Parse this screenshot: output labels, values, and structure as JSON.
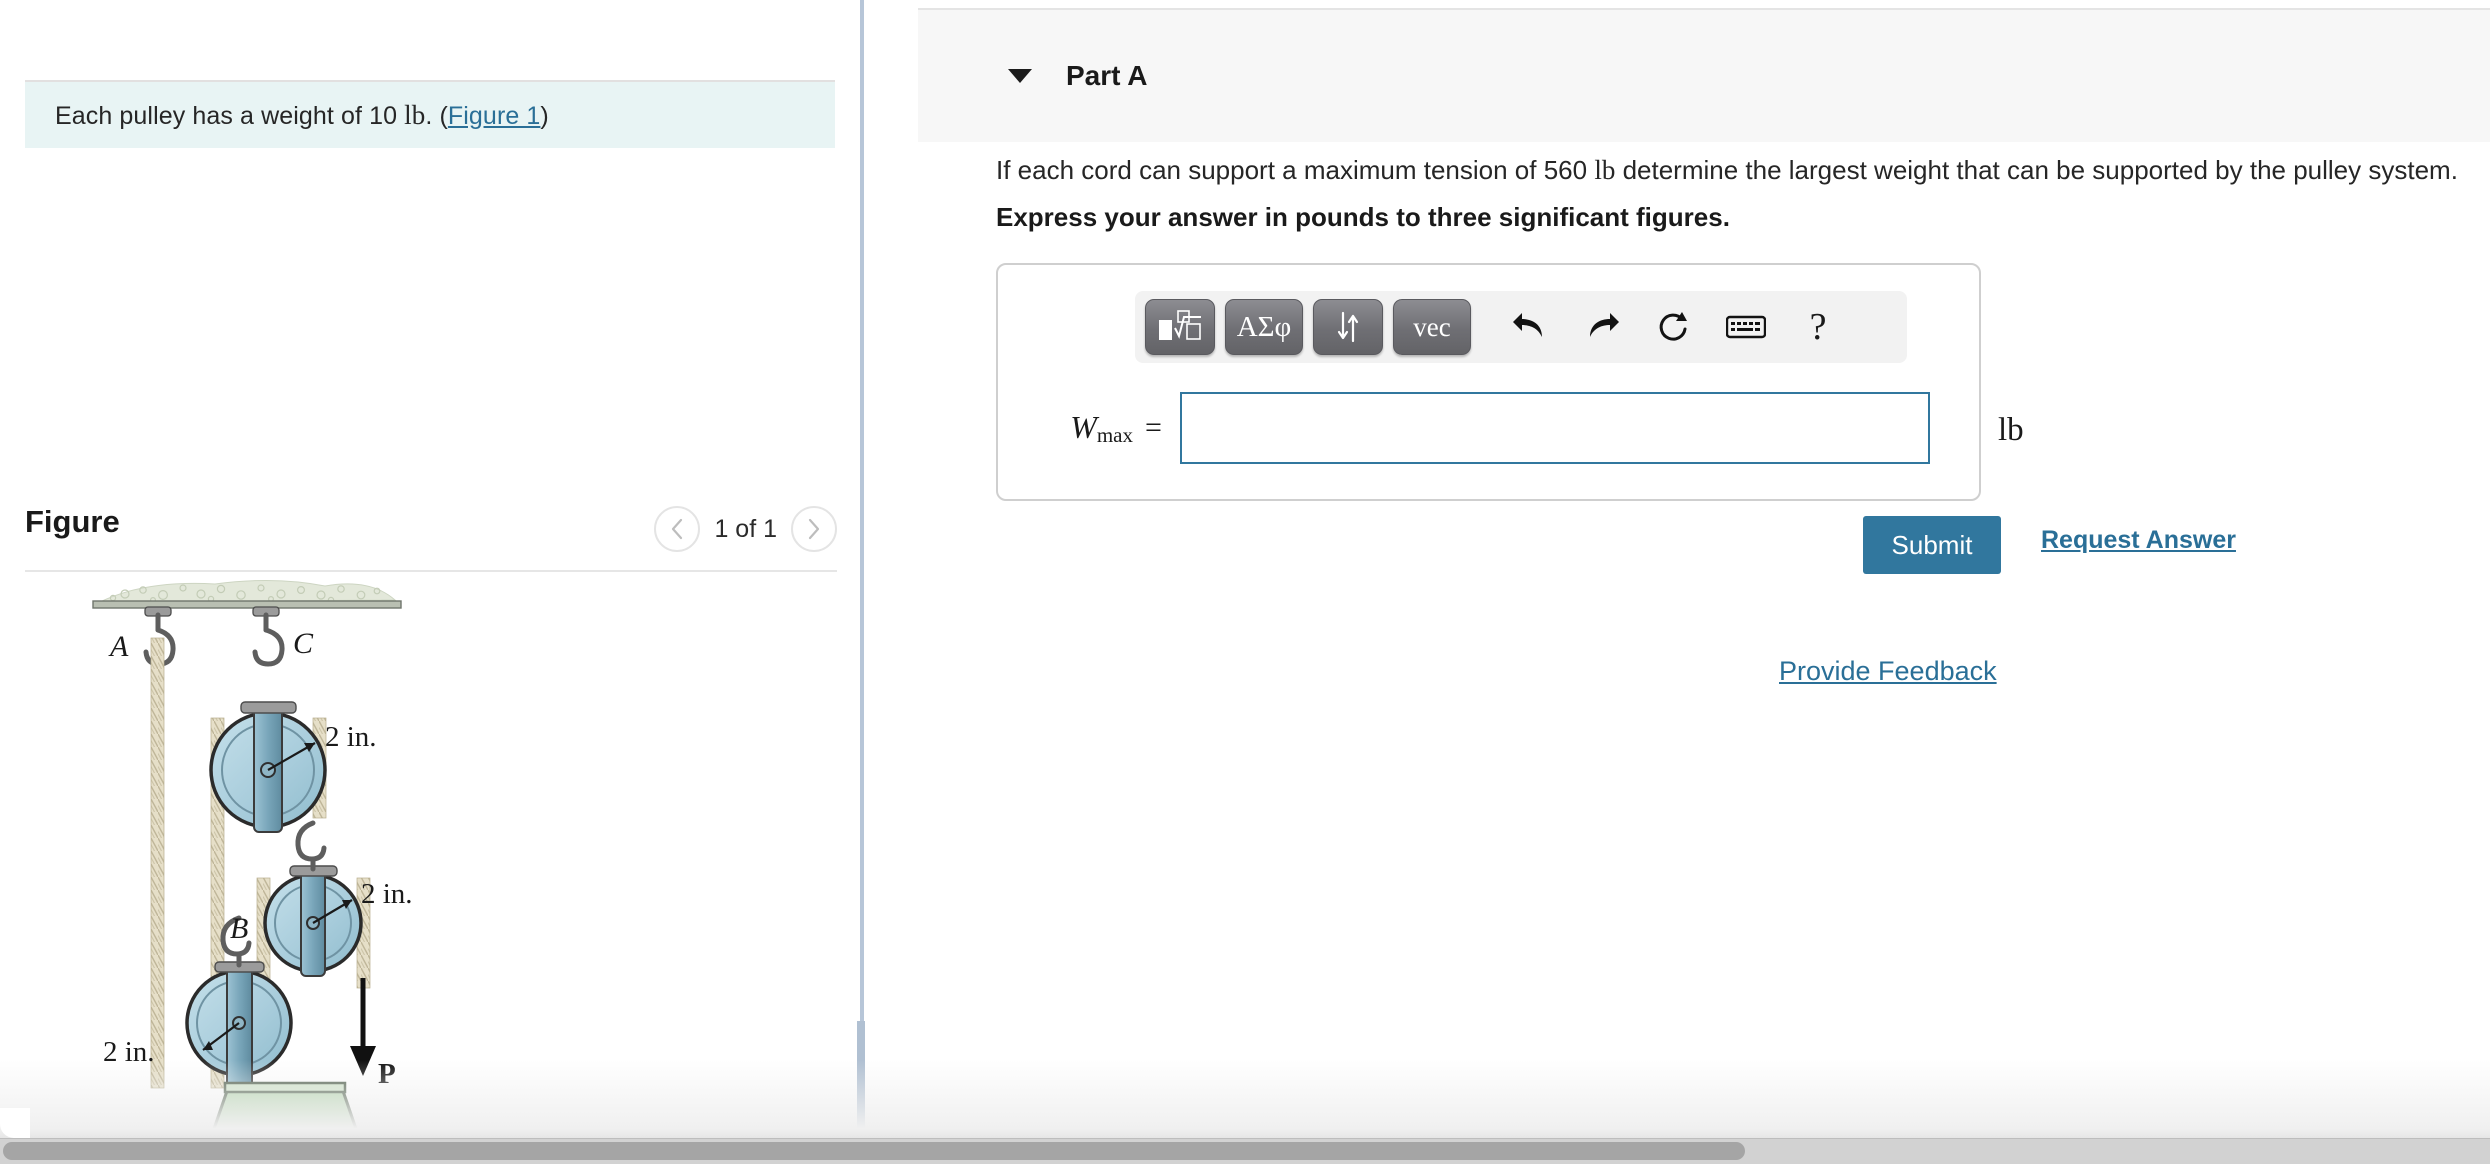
{
  "problem": {
    "statement_prefix": "Each pulley has a weight of 10 ",
    "statement_unit": "lb",
    "statement_suffix": ". (",
    "figure_link": "Figure 1",
    "statement_close": ")"
  },
  "figure_panel": {
    "title": "Figure",
    "pager_count": "1 of 1",
    "prev_icon": "chevron-left-icon",
    "next_icon": "chevron-right-icon"
  },
  "figure_diagram": {
    "labels": {
      "a": "A",
      "b": "B",
      "c": "C",
      "force": "P",
      "radius_top": "2 in.",
      "radius_mid": "2 in.",
      "radius_bottom": "2 in."
    },
    "colors": {
      "pulley_fill": "#a9cddc",
      "pulley_edge": "#2b2b2b",
      "bracket": "#7fa9bd",
      "block_fill": "#b6d5b0",
      "block_edge": "#4f5f4c",
      "rope": "#e3dcc4",
      "ceiling": "#dfe5d6",
      "hook": "#6d6d6d"
    }
  },
  "part": {
    "caret_icon": "caret-down-icon",
    "title": "Part A",
    "question": "If each cord can support a maximum tension of 560 lb determine the largest weight that can be supported by the pulley system.",
    "question_pre": "If each cord can support a maximum tension of 560 ",
    "question_unit": "lb",
    "question_post": " determine the largest weight that can be supported by the pulley system.",
    "instruction": "Express your answer in pounds to three significant figures."
  },
  "answer": {
    "label_symbol": "W",
    "label_sub": "max",
    "equals": "=",
    "value": "",
    "placeholder": "",
    "unit": "lb",
    "toolbar": [
      {
        "name": "template-sqrt-button",
        "glyph": "■√□",
        "type": "key"
      },
      {
        "name": "greek-symbols-button",
        "glyph": "ΑΣφ",
        "type": "key"
      },
      {
        "name": "arrows-updown-button",
        "glyph": "⇅",
        "type": "key"
      },
      {
        "name": "vector-button",
        "glyph": "vec",
        "type": "key"
      },
      {
        "name": "undo-button",
        "glyph": "↶",
        "type": "icon"
      },
      {
        "name": "redo-button",
        "glyph": "↷",
        "type": "icon"
      },
      {
        "name": "reset-button",
        "glyph": "⟳",
        "type": "icon"
      },
      {
        "name": "keyboard-button",
        "glyph": "⌨",
        "type": "icon"
      },
      {
        "name": "help-button",
        "glyph": "?",
        "type": "icon"
      }
    ]
  },
  "actions": {
    "submit_label": "Submit",
    "request_answer_label": "Request Answer",
    "provide_feedback_label": "Provide Feedback"
  },
  "colors": {
    "accent_blue": "#31779e",
    "link_blue": "#2a6f97",
    "statement_bg": "#e8f4f4",
    "part_header_bg": "#f7f7f7",
    "divider": "#b7c6d8"
  }
}
